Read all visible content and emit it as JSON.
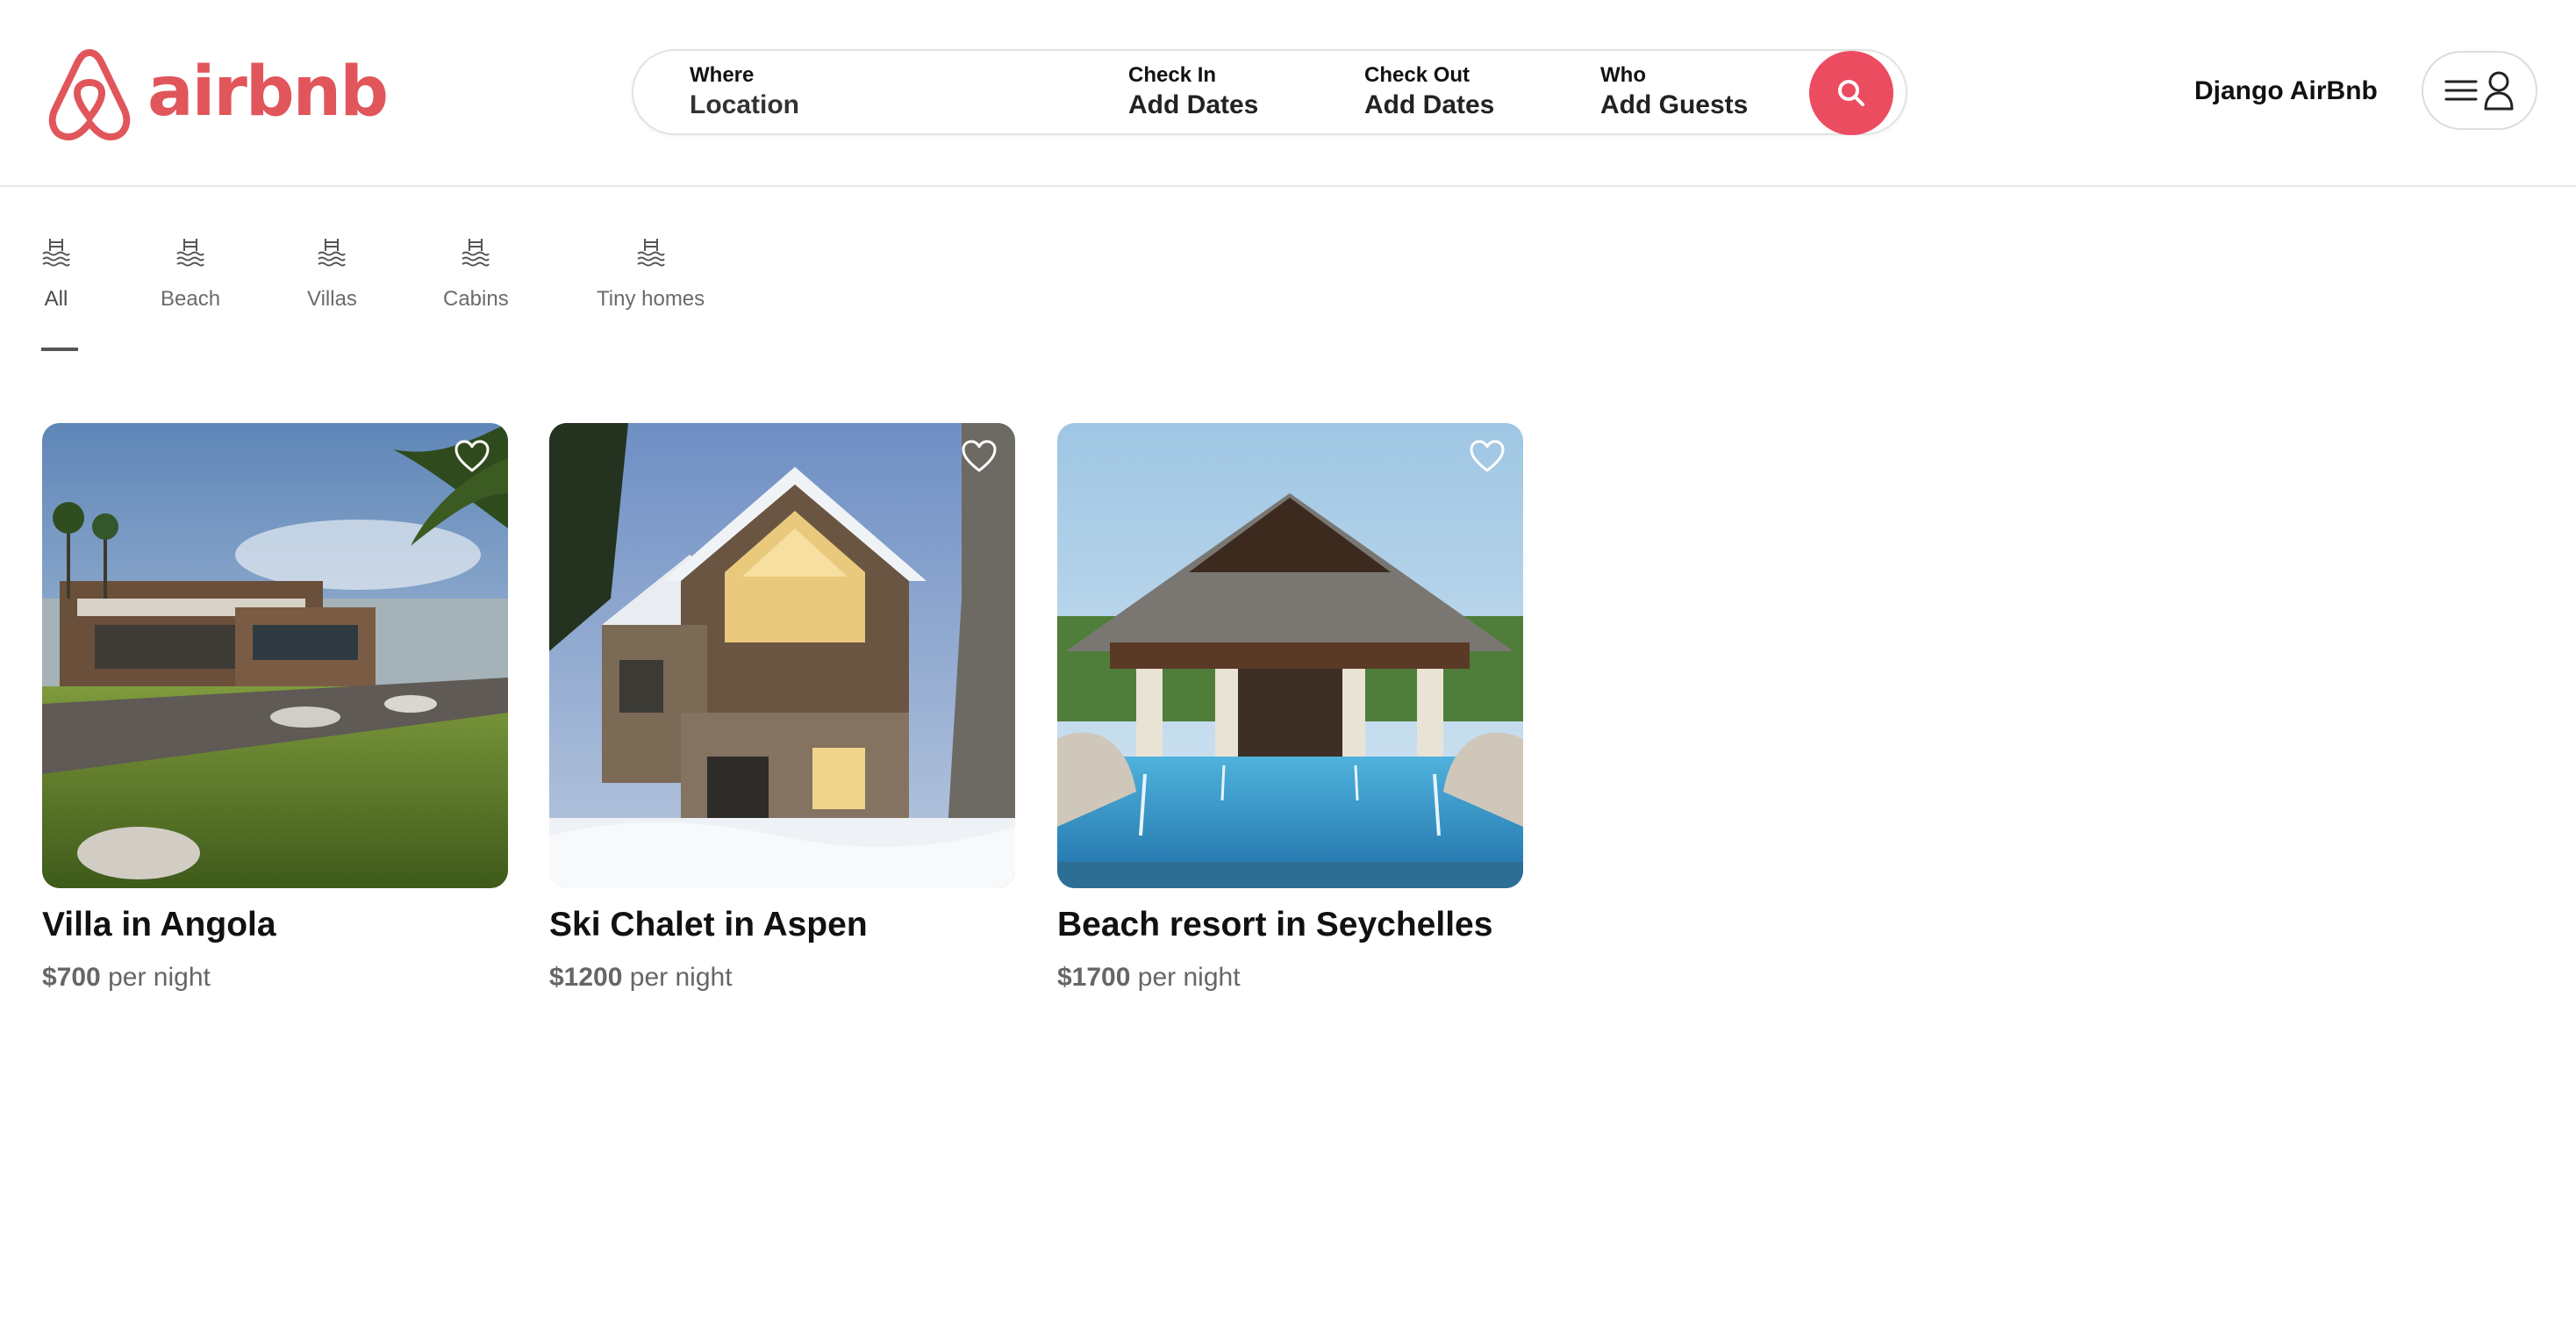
{
  "brand": {
    "name": "airbnb",
    "color": "#e0565b"
  },
  "search": {
    "where": {
      "label": "Where",
      "value": "Location"
    },
    "check_in": {
      "label": "Check In",
      "value": "Add Dates"
    },
    "check_out": {
      "label": "Check Out",
      "value": "Add Dates"
    },
    "who": {
      "label": "Who",
      "value": "Add Guests"
    },
    "button_icon": "search-icon",
    "accent": "#ec4c60"
  },
  "header": {
    "host_link": "Django AirBnb",
    "menu_icons": [
      "hamburger-icon",
      "user-icon"
    ]
  },
  "categories": {
    "active": "All",
    "items": [
      {
        "label": "All",
        "icon": "waves-icon"
      },
      {
        "label": "Beach",
        "icon": "waves-icon"
      },
      {
        "label": "Villas",
        "icon": "waves-icon"
      },
      {
        "label": "Cabins",
        "icon": "waves-icon"
      },
      {
        "label": "Tiny homes",
        "icon": "waves-icon"
      }
    ]
  },
  "listings": [
    {
      "title": "Villa in Angola",
      "price": "$700",
      "price_suffix": "per night",
      "favorite_icon": "heart-icon"
    },
    {
      "title": "Ski Chalet in Aspen",
      "price": "$1200",
      "price_suffix": "per night",
      "favorite_icon": "heart-icon"
    },
    {
      "title": "Beach resort in Seychelles",
      "price": "$1700",
      "price_suffix": "per night",
      "favorite_icon": "heart-icon"
    }
  ]
}
